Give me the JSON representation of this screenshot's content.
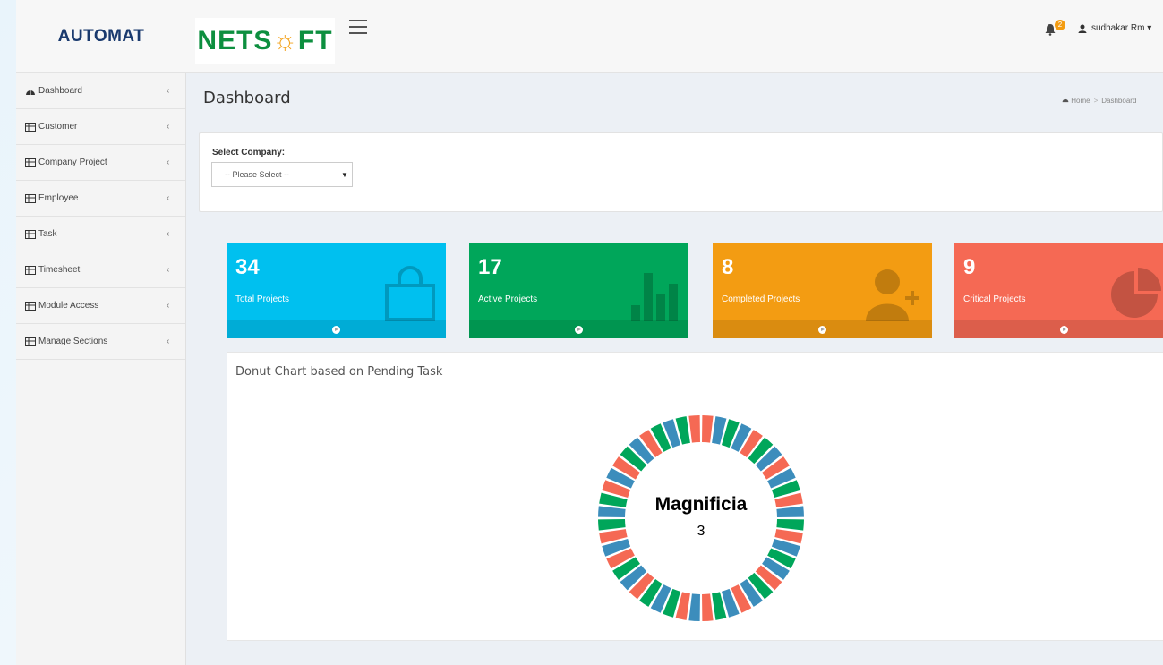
{
  "header": {
    "brand": "AUTOMAT",
    "logo_text_left": "NETS",
    "logo_text_sun": "☼",
    "logo_text_right": "FT",
    "notification_count": "2",
    "user_name": "sudhakar Rm ▾"
  },
  "sidebar": {
    "items": [
      {
        "label": "Dashboard",
        "icon": "dashboard-icon"
      },
      {
        "label": "Customer",
        "icon": "table-icon"
      },
      {
        "label": "Company Project",
        "icon": "table-icon"
      },
      {
        "label": "Employee",
        "icon": "table-icon"
      },
      {
        "label": "Task",
        "icon": "table-icon"
      },
      {
        "label": "Timesheet",
        "icon": "table-icon"
      },
      {
        "label": "Module Access",
        "icon": "table-icon"
      },
      {
        "label": "Manage Sections",
        "icon": "table-icon"
      }
    ],
    "chevron": "‹"
  },
  "page": {
    "title": "Dashboard",
    "breadcrumb_home": "Home",
    "breadcrumb_sep": ">",
    "breadcrumb_current": "Dashboard"
  },
  "filter": {
    "label": "Select Company:",
    "selected": "-- Please Select --"
  },
  "stats": [
    {
      "value": "34",
      "label": "Total Projects",
      "color": "#00c0ef",
      "icon": "shopping-bag-icon"
    },
    {
      "value": "17",
      "label": "Active Projects",
      "color": "#00a65a",
      "icon": "bar-chart-icon"
    },
    {
      "value": "8",
      "label": "Completed Projects",
      "color": "#f39c12",
      "icon": "user-plus-icon"
    },
    {
      "value": "9",
      "label": "Critical Projects",
      "color": "#f56954",
      "icon": "pie-chart-icon"
    }
  ],
  "chart_panel": {
    "title": "Donut Chart based on Pending Task",
    "center_label": "Magnificia",
    "center_value": "3"
  },
  "chart_data": {
    "type": "pie",
    "colors": [
      "#f56954",
      "#3c8dbc",
      "#00a65a"
    ],
    "segment_count": 48
  }
}
